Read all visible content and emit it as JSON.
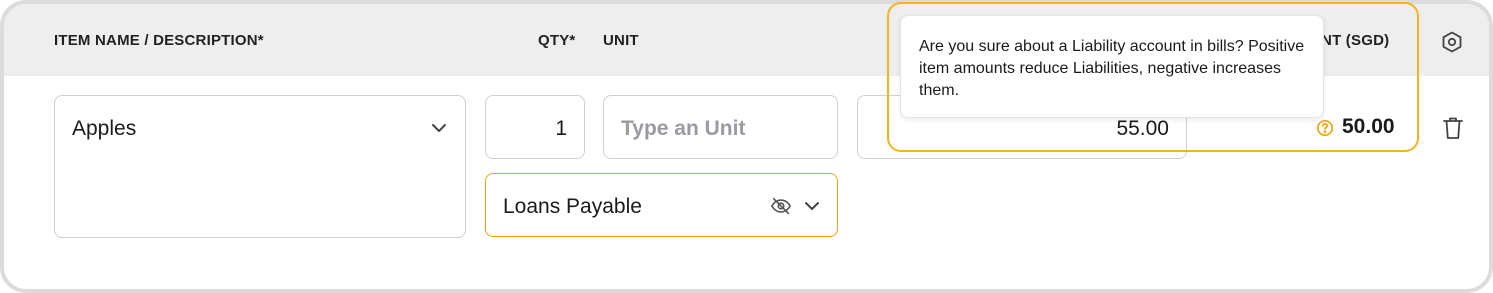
{
  "header": {
    "col_item": "ITEM NAME / DESCRIPTION*",
    "col_qty": "QTY*",
    "col_unit": "UNIT",
    "col_amount_partial": "UNT (SGD)"
  },
  "row": {
    "item_value": "Apples",
    "qty_value": "1",
    "unit_placeholder": "Type an Unit",
    "account_value": "Loans Payable",
    "price_value": "55.00",
    "amount_value": "50.00"
  },
  "tooltip": {
    "text": "Are you sure about a Liability account in bills? Positive item amounts reduce Liabilities, negative increases them."
  },
  "icons": {
    "settings": "hexagon-settings-icon",
    "delete": "trash-icon",
    "warning": "question-circle-icon",
    "hidden": "eye-off-icon",
    "dropdown": "chevron-down-icon"
  },
  "colors": {
    "accent": "#f0a20a",
    "header_bg": "#eeeeef",
    "border": "#cfcfd3"
  }
}
